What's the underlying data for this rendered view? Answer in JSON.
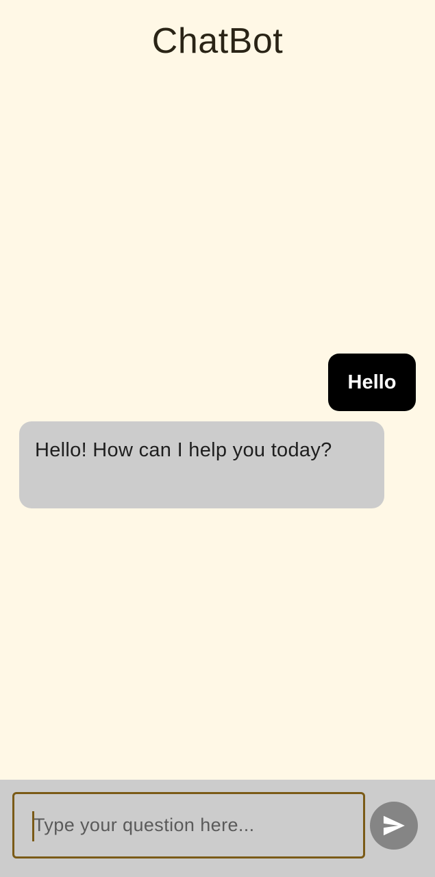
{
  "app": {
    "title": "ChatBot"
  },
  "messages": [
    {
      "role": "user",
      "text": "Hello"
    },
    {
      "role": "bot",
      "text": "Hello! How can I help you today?"
    }
  ],
  "composer": {
    "placeholder": "Type your question here...",
    "value": "",
    "send_icon": "send-icon"
  },
  "colors": {
    "background": "#FFF8E6",
    "user_bubble": "#000000",
    "bot_bubble": "#CCCCCC",
    "input_bar": "#CCCCCC",
    "input_border": "#7A5A16",
    "send_button": "#858585"
  }
}
